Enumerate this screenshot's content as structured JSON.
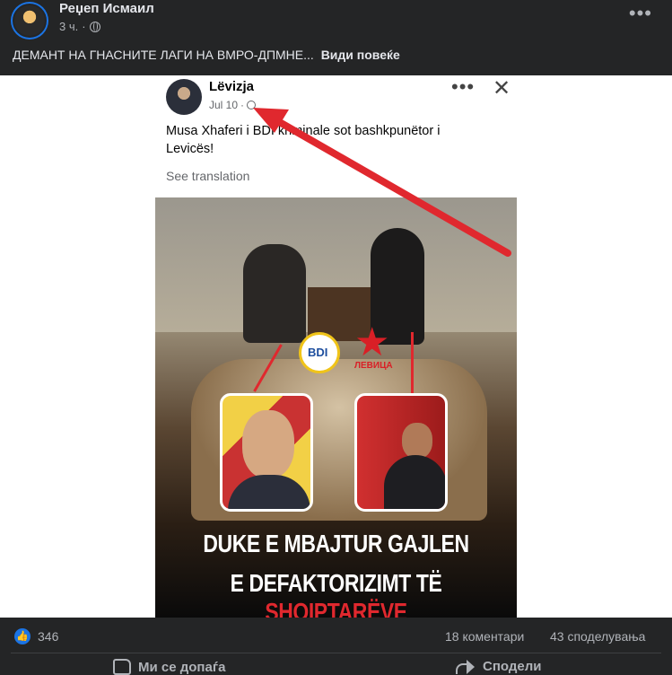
{
  "post": {
    "author": "Реџеп Исмаил",
    "time": "3 ч.",
    "caption": "ДЕМАНТ НА ГНАСНИТЕ ЛАГИ НА ВМРО-ДПМНЕ...",
    "see_more": "Види повеќе"
  },
  "shared_screenshot": {
    "page_name": "Lëvizja",
    "date": "Jul 10",
    "text": "Musa Xhaferi i BDI kriminale sot bashkpunëtor i Levicës!",
    "see_translation": "See translation",
    "image": {
      "logo_left": "BDI",
      "logo_right_label": "ЛЕВИЦА",
      "headline_line1": "DUKE E MBAJTUR GAJLEN",
      "headline_line2_start": "E DEFAKTORIZIMT TË ",
      "headline_line2_accent": "SHQIPTARËVE"
    }
  },
  "stats": {
    "likes": "346",
    "comments": "18 коментари",
    "shares": "43 споделувања"
  },
  "actions": {
    "like": "Ми се допаѓа",
    "share": "Сподели"
  },
  "colors": {
    "background": "#242526",
    "accent": "#1b74e4",
    "arrow": "#e0282e"
  }
}
